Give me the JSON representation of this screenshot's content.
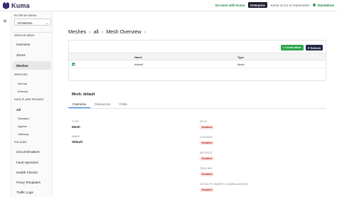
{
  "header": {
    "app_name": "Kuma",
    "do_more": "Do more with Kuma",
    "enterprise_label": "Enterprise",
    "version_text": "Kuma v1.0.2 on Kubernetes",
    "mode_label": "Standalone",
    "mode_color": "#2da44e"
  },
  "sidebar": {
    "filter_label": "FILTER BY MESH:",
    "mesh_select_value": "All Meshes",
    "service_mesh_label": "SERVICE MESH",
    "service_mesh_items": [
      "Overview",
      "Zones",
      "Meshes"
    ],
    "active_item": "Meshes",
    "services_label": "SERVICES",
    "services_items": [
      "Internal",
      "External"
    ],
    "dpp_label": "DATA PLANE PROXIES",
    "dpp_all": "All",
    "dpp_items": [
      "Standard",
      "Ingress",
      "Gateway"
    ],
    "policies_label": "POLICIES",
    "policies_items": [
      "Circuit Breakers",
      "Fault Injections",
      "Health Checks",
      "Proxy Templates",
      "Traffic Logs"
    ]
  },
  "main": {
    "breadcrumb": [
      "Meshes",
      "all",
      "Mesh Overview"
    ],
    "create_button": "+ Create Mesh",
    "refresh_button": "Refresh",
    "table": {
      "headers": [
        "",
        "Name",
        "Type"
      ],
      "rows": [
        {
          "status": "online",
          "name": "default",
          "type": "Mesh"
        }
      ]
    },
    "mesh_title": "Mesh: default",
    "tabs": [
      "Overview",
      "Resources",
      "YAML"
    ],
    "active_tab": "Overview",
    "overview": {
      "type_label": "TYPE",
      "type_value": "Mesh",
      "name_label": "NAME",
      "name_value": "default",
      "mtls_label": "MTLS",
      "mtls_value": "Disabled",
      "logging_label": "LOGGING",
      "logging_value": "Disabled",
      "metrics_label": "METRICS",
      "metrics_value": "Disabled",
      "tracing_label": "TRACING",
      "tracing_value": "Disabled",
      "locality_label": "LOCALITY AWARE LOADBALANCING",
      "locality_value": "Disabled"
    }
  },
  "colors": {
    "brand": "#3b2a7a",
    "accent_green": "#2da44e",
    "disabled_badge_text": "#b42318",
    "disabled_badge_bg": "#fde8e8"
  }
}
